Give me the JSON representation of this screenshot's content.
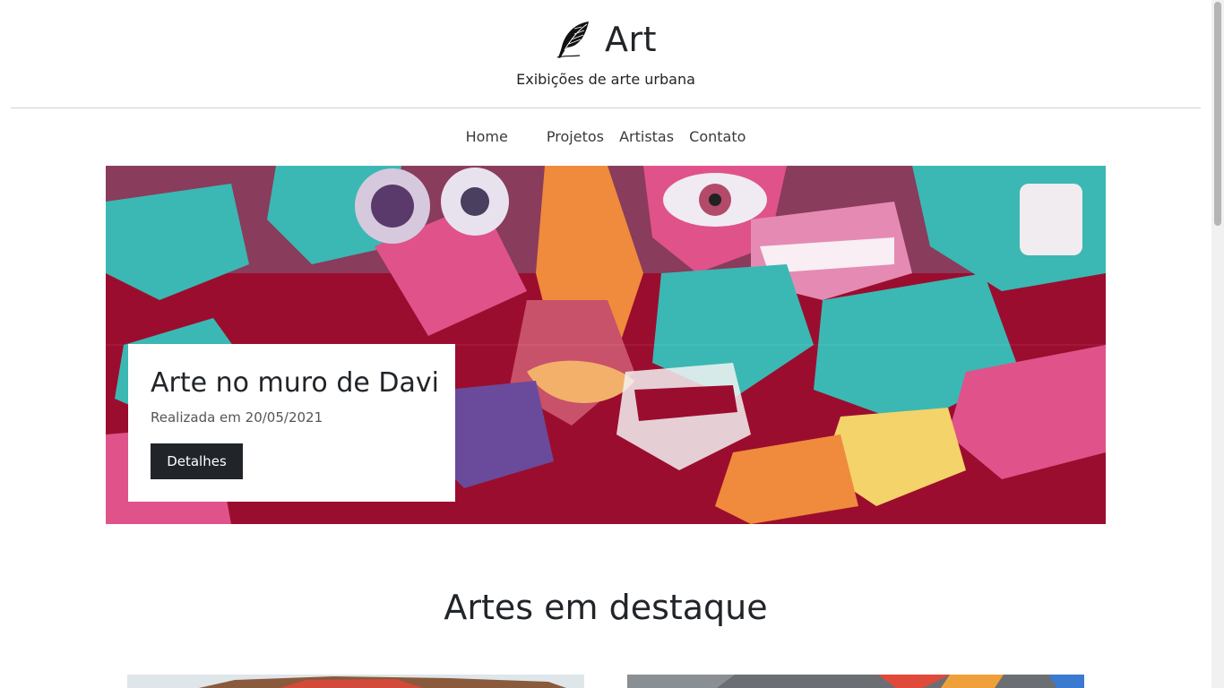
{
  "site": {
    "logo_text": "Art",
    "tagline": "Exibições de arte urbana",
    "logo_icon": "feather-icon"
  },
  "nav": {
    "items": [
      {
        "label": "Home"
      },
      {
        "label": "Projetos"
      },
      {
        "label": "Artistas"
      },
      {
        "label": "Contato"
      }
    ]
  },
  "hero": {
    "title": "Arte no muro de Davi",
    "date_text": "Realizada em 20/05/2021",
    "button_label": "Detalhes"
  },
  "featured": {
    "title": "Artes em destaque"
  },
  "colors": {
    "text": "#212529",
    "button_bg": "#212529",
    "mural_teal": "#3bb8b3",
    "mural_red": "#9b0d2e",
    "mural_pink": "#e0528a",
    "mural_orange": "#f08a3c"
  }
}
